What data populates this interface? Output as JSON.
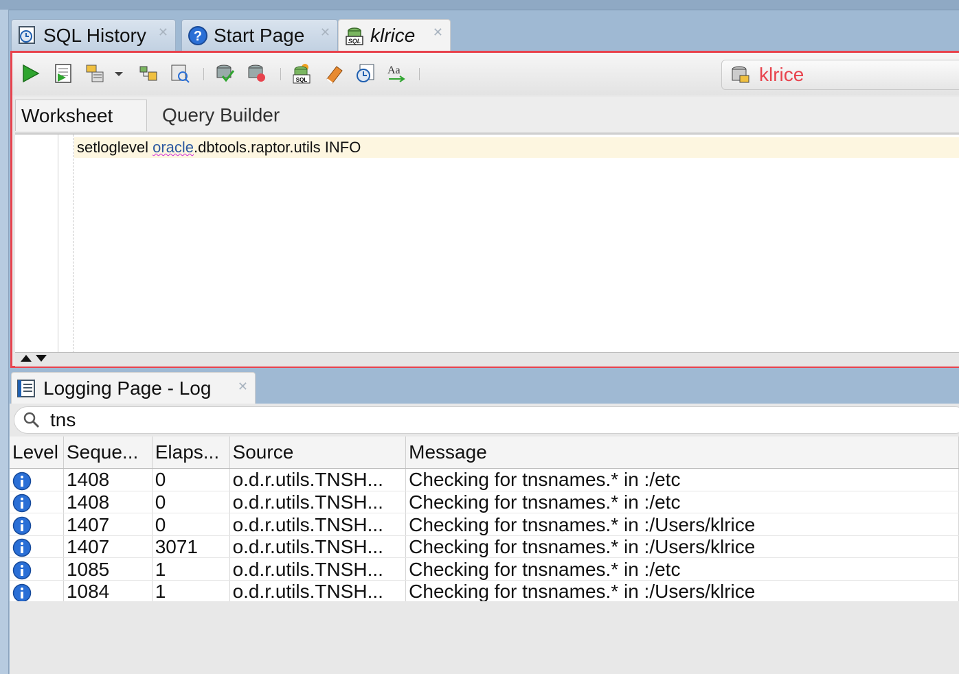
{
  "tabs": [
    {
      "label": "SQL History",
      "icon": "sql-history-icon",
      "active": false
    },
    {
      "label": "Start Page",
      "icon": "help-icon",
      "active": false
    },
    {
      "label": "klrice",
      "icon": "sql-worksheet-icon",
      "active": true
    }
  ],
  "toolbar": {
    "buttons": [
      "run-statement-icon",
      "run-script-icon",
      "autotrace-icon",
      "dropdown-arrow-icon",
      "explain-plan-icon",
      "sql-tuning-advisor-icon",
      "commit-icon",
      "rollback-icon",
      "unshared-sql-worksheet-icon",
      "clear-icon",
      "sql-history-icon",
      "format-icon"
    ],
    "connection": "klrice"
  },
  "worksheet": {
    "tabs": [
      "Worksheet",
      "Query Builder"
    ],
    "code": {
      "pre": "setloglevel ",
      "keyword": "oracle",
      "post": ".dbtools.raptor.utils INFO"
    }
  },
  "log": {
    "tab_title": "Logging Page - Log",
    "search_value": "tns",
    "columns": [
      "Level",
      "Seque...",
      "Elaps...",
      "Source",
      "Message"
    ],
    "rows": [
      {
        "seq": "1408",
        "elapsed": "0",
        "source": "o.d.r.utils.TNSH...",
        "message": "Checking for tnsnames.* in :/etc"
      },
      {
        "seq": "1408",
        "elapsed": "0",
        "source": "o.d.r.utils.TNSH...",
        "message": "Checking for tnsnames.* in :/etc"
      },
      {
        "seq": "1407",
        "elapsed": "0",
        "source": "o.d.r.utils.TNSH...",
        "message": "Checking for tnsnames.* in :/Users/klrice"
      },
      {
        "seq": "1407",
        "elapsed": "3071",
        "source": "o.d.r.utils.TNSH...",
        "message": "Checking for tnsnames.* in :/Users/klrice"
      },
      {
        "seq": "1085",
        "elapsed": "1",
        "source": "o.d.r.utils.TNSH...",
        "message": "Checking for tnsnames.* in :/etc"
      },
      {
        "seq": "1084",
        "elapsed": "1",
        "source": "o.d.r.utils.TNSH...",
        "message": "Checking for tnsnames.* in :/Users/klrice"
      }
    ]
  },
  "colors": {
    "accent_red": "#e8434d",
    "info_blue": "#2a6fd6"
  }
}
